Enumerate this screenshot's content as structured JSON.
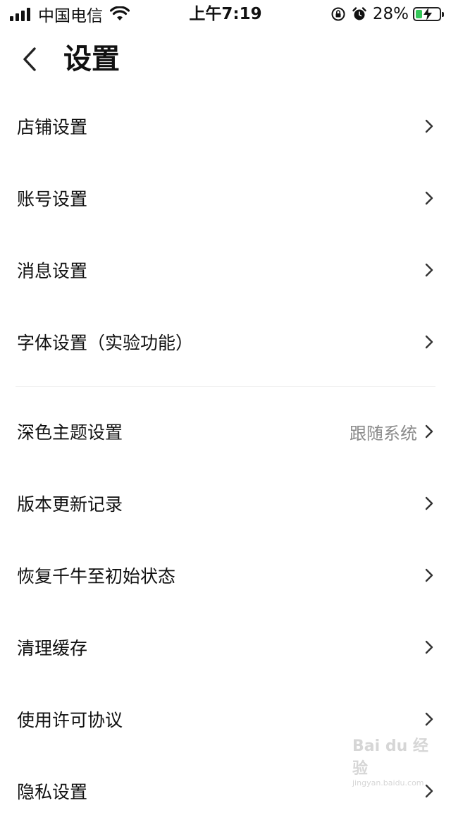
{
  "status_bar": {
    "carrier": "中国电信",
    "time": "上午7:19",
    "battery_percent": "28%",
    "battery_level": 0.28,
    "icons": [
      "signal-icon",
      "wifi-icon",
      "orientation-lock-icon",
      "alarm-icon",
      "battery-charging-icon"
    ]
  },
  "header": {
    "title": "设置",
    "back_icon": "chevron-left-icon"
  },
  "settings": {
    "group1": [
      {
        "label": "店铺设置"
      },
      {
        "label": "账号设置"
      },
      {
        "label": "消息设置"
      },
      {
        "label": "字体设置（实验功能）"
      }
    ],
    "group2": [
      {
        "label": "深色主题设置",
        "value": "跟随系统"
      },
      {
        "label": "版本更新记录"
      },
      {
        "label": "恢复千牛至初始状态"
      },
      {
        "label": "清理缓存"
      },
      {
        "label": "使用许可协议"
      },
      {
        "label": "隐私设置"
      }
    ]
  },
  "watermark": {
    "logo_text": "Bai du 经验",
    "url": "jingyan.baidu.com"
  },
  "colors": {
    "text_primary": "#111111",
    "text_secondary": "#8a8a8a",
    "divider": "#ececec",
    "battery_green": "#35c759"
  }
}
